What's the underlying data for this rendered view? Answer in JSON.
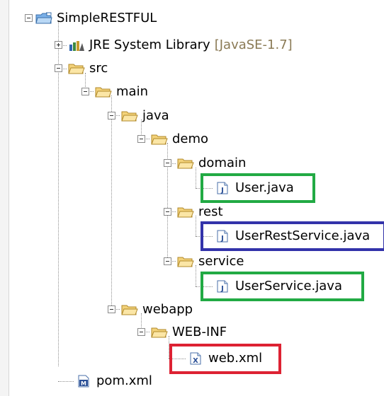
{
  "colors": {
    "folder": "#e8c45a",
    "highlight_green": "#22aa44",
    "highlight_blue": "#3333aa",
    "highlight_red": "#dd2233"
  },
  "tree": {
    "project": "SimpleRESTFUL",
    "jre": {
      "label": "JRE System Library",
      "decoration": "[JavaSE-1.7]"
    },
    "src": "src",
    "main": "main",
    "java": "java",
    "demo": "demo",
    "domain": "domain",
    "user_java": "User.java",
    "rest": "rest",
    "user_rest_service_java": "UserRestService.java",
    "service": "service",
    "user_service_java": "UserService.java",
    "webapp": "webapp",
    "web_inf": "WEB-INF",
    "web_xml": "web.xml",
    "pom_xml": "pom.xml"
  },
  "icons": {
    "project": "project-folder-icon",
    "jre": "library-icon",
    "folder": "folder-icon",
    "java_file": "java-file-icon",
    "xml_file": "xml-file-icon",
    "maven_file": "maven-pom-icon"
  }
}
